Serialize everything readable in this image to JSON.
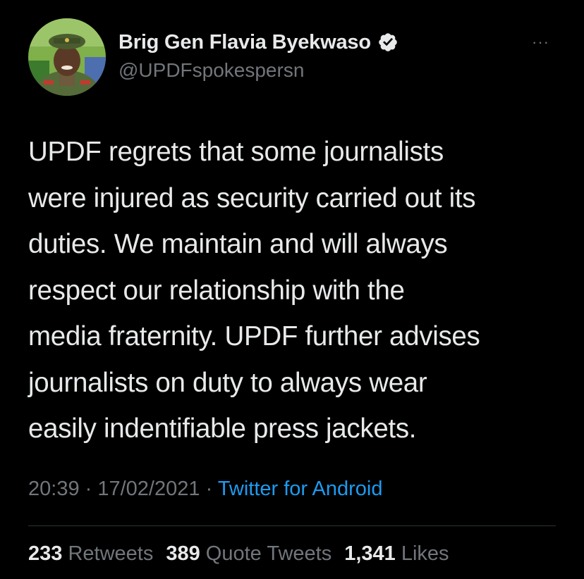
{
  "author": {
    "display_name": "Brig Gen Flavia Byekwaso",
    "handle": "@UPDFspokespersn",
    "verified": true,
    "verified_icon": "verified-badge-icon",
    "avatar_icon": "avatar-photo"
  },
  "more_label": "···",
  "tweet": {
    "lines": [
      "UPDF regrets that some journalists",
      "were injured as security carried out its",
      "duties. We maintain and will always",
      "respect our relationship with the",
      "media fraternity. UPDF further advises",
      "journalists on duty to always wear",
      "easily indentifiable press jackets."
    ]
  },
  "meta": {
    "time": "20:39",
    "separator": " · ",
    "date": "17/02/2021",
    "source": "Twitter for Android"
  },
  "stats": {
    "retweets": {
      "count": "233",
      "label": "Retweets"
    },
    "quote_tweets": {
      "count": "389",
      "label": "Quote Tweets"
    },
    "likes": {
      "count": "1,341",
      "label": "Likes"
    }
  },
  "colors": {
    "background": "#000000",
    "text": "#e7e9ea",
    "secondary": "#71767b",
    "link": "#1d9bf0",
    "divider": "#2f3336"
  }
}
